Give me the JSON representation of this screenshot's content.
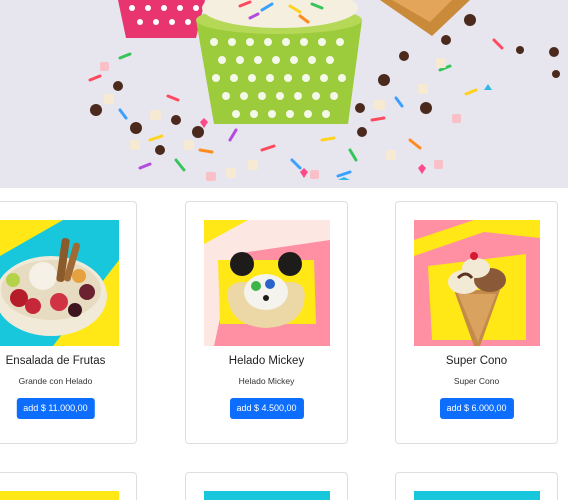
{
  "products": [
    {
      "title": "Ensalada de Frutas",
      "subtitle": "Grande con Helado",
      "button": "add $ 11.000,00"
    },
    {
      "title": "Helado Mickey",
      "subtitle": "Helado Mickey",
      "button": "add $ 4.500,00"
    },
    {
      "title": "Super Cono",
      "subtitle": "Super Cono",
      "button": "add $ 6.000,00"
    }
  ],
  "colors": {
    "button": "#0d6efd",
    "thumb_yellow": "#ffe816",
    "thumb_cyan": "#19c7dc",
    "thumb_pink": "#ff8fa3"
  }
}
